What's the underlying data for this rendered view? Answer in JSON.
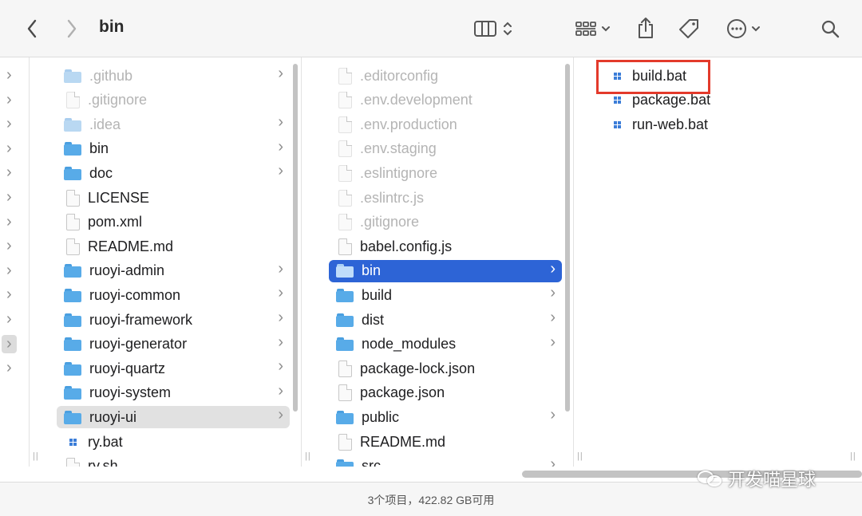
{
  "toolbar": {
    "title": "bin",
    "back_icon": "chevron-left",
    "forward_icon": "chevron-right",
    "view_icon": "columns-view-icon",
    "group_icon": "grid-group-icon",
    "share_icon": "share-icon",
    "tag_icon": "tag-icon",
    "more_icon": "ellipsis-circle-icon",
    "search_icon": "search-icon"
  },
  "column1": {
    "items": [
      {
        "label": ".github",
        "type": "folder",
        "dim": true,
        "chevron": true
      },
      {
        "label": ".gitignore",
        "type": "file",
        "dim": true,
        "chevron": false
      },
      {
        "label": ".idea",
        "type": "folder",
        "dim": true,
        "chevron": true
      },
      {
        "label": "bin",
        "type": "folder",
        "dim": false,
        "chevron": true
      },
      {
        "label": "doc",
        "type": "folder",
        "dim": false,
        "chevron": true
      },
      {
        "label": "LICENSE",
        "type": "file",
        "dim": false,
        "chevron": false
      },
      {
        "label": "pom.xml",
        "type": "file",
        "dim": false,
        "chevron": false
      },
      {
        "label": "README.md",
        "type": "file",
        "dim": false,
        "chevron": false
      },
      {
        "label": "ruoyi-admin",
        "type": "folder",
        "dim": false,
        "chevron": true
      },
      {
        "label": "ruoyi-common",
        "type": "folder",
        "dim": false,
        "chevron": true
      },
      {
        "label": "ruoyi-framework",
        "type": "folder",
        "dim": false,
        "chevron": true
      },
      {
        "label": "ruoyi-generator",
        "type": "folder",
        "dim": false,
        "chevron": true
      },
      {
        "label": "ruoyi-quartz",
        "type": "folder",
        "dim": false,
        "chevron": true
      },
      {
        "label": "ruoyi-system",
        "type": "folder",
        "dim": false,
        "chevron": true
      },
      {
        "label": "ruoyi-ui",
        "type": "folder",
        "dim": false,
        "chevron": true,
        "state": "hover"
      },
      {
        "label": "ry.bat",
        "type": "bat",
        "dim": false,
        "chevron": false
      },
      {
        "label": "ry.sh",
        "type": "file",
        "dim": false,
        "chevron": false
      }
    ]
  },
  "column2": {
    "items": [
      {
        "label": ".editorconfig",
        "type": "file",
        "dim": true,
        "chevron": false
      },
      {
        "label": ".env.development",
        "type": "file",
        "dim": true,
        "chevron": false
      },
      {
        "label": ".env.production",
        "type": "file",
        "dim": true,
        "chevron": false
      },
      {
        "label": ".env.staging",
        "type": "file",
        "dim": true,
        "chevron": false
      },
      {
        "label": ".eslintignore",
        "type": "file",
        "dim": true,
        "chevron": false
      },
      {
        "label": ".eslintrc.js",
        "type": "file",
        "dim": true,
        "chevron": false
      },
      {
        "label": ".gitignore",
        "type": "file",
        "dim": true,
        "chevron": false
      },
      {
        "label": "babel.config.js",
        "type": "file",
        "dim": false,
        "chevron": false
      },
      {
        "label": "bin",
        "type": "folder",
        "dim": false,
        "chevron": true,
        "state": "selected"
      },
      {
        "label": "build",
        "type": "folder",
        "dim": false,
        "chevron": true
      },
      {
        "label": "dist",
        "type": "folder",
        "dim": false,
        "chevron": true
      },
      {
        "label": "node_modules",
        "type": "folder",
        "dim": false,
        "chevron": true
      },
      {
        "label": "package-lock.json",
        "type": "file",
        "dim": false,
        "chevron": false
      },
      {
        "label": "package.json",
        "type": "file",
        "dim": false,
        "chevron": false
      },
      {
        "label": "public",
        "type": "folder",
        "dim": false,
        "chevron": true
      },
      {
        "label": "README.md",
        "type": "file",
        "dim": false,
        "chevron": false
      },
      {
        "label": "src",
        "type": "folder",
        "dim": false,
        "chevron": true
      }
    ]
  },
  "column3": {
    "items": [
      {
        "label": "build.bat",
        "type": "bat",
        "dim": false,
        "chevron": false
      },
      {
        "label": "package.bat",
        "type": "bat",
        "dim": false,
        "chevron": false
      },
      {
        "label": "run-web.bat",
        "type": "bat",
        "dim": false,
        "chevron": false
      }
    ]
  },
  "status": {
    "text": "3个项目，422.82 GB可用"
  },
  "watermark": {
    "text": "开发喵星球"
  },
  "colors": {
    "selection": "#2d64d6",
    "highlight_box": "#e33a2b",
    "folder": "#58abe8"
  }
}
